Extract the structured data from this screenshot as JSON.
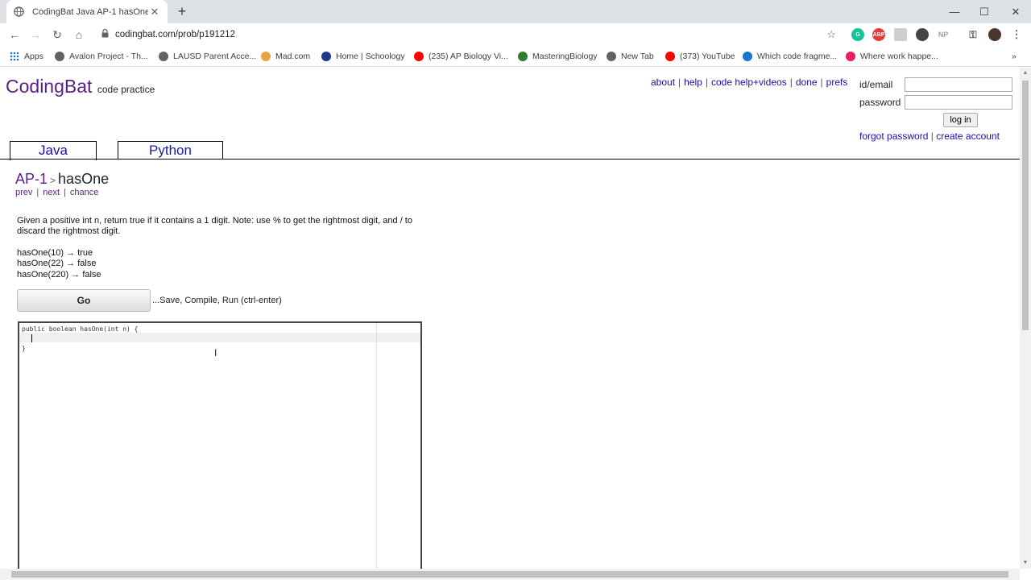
{
  "browser": {
    "tab_title": "CodingBat Java AP-1 hasOne",
    "url": "codingbat.com/prob/p191212",
    "bookmarks": [
      {
        "label": "Apps",
        "color": "#1a73e8"
      },
      {
        "label": "Avalon Project - Th...",
        "color": "#5f6368"
      },
      {
        "label": "LAUSD Parent Acce...",
        "color": "#5f6368"
      },
      {
        "label": "Mad.com",
        "color": "#e8a33d"
      },
      {
        "label": "Home | Schoology",
        "color": "#1e3a8a"
      },
      {
        "label": "(235) AP Biology Vi...",
        "color": "#ff0000"
      },
      {
        "label": "MasteringBiology",
        "color": "#2e7d32"
      },
      {
        "label": "New Tab",
        "color": "#5f6368"
      },
      {
        "label": "(373) YouTube",
        "color": "#ff0000"
      },
      {
        "label": "Which code fragme...",
        "color": "#1976d2"
      },
      {
        "label": "Where work happe...",
        "color": "#e91e63"
      }
    ],
    "extensions": {
      "grammarly": "G",
      "adblock": "ABP",
      "np": "NP"
    }
  },
  "site": {
    "brand": "CodingBat",
    "tagline": "code practice",
    "top_links": [
      "about",
      "help",
      "code help+videos",
      "done",
      "prefs"
    ],
    "login": {
      "id_label": "id/email",
      "password_label": "password",
      "button": "log in",
      "forgot": "forgot password",
      "create": "create account"
    },
    "tabs": [
      "Java",
      "Python"
    ]
  },
  "problem": {
    "category": "AP-1",
    "name": "hasOne",
    "nav": [
      "prev",
      "next",
      "chance"
    ],
    "description": "Given a positive int n, return true if it contains a 1 digit. Note: use % to get the rightmost digit, and / to discard the rightmost digit.",
    "examples": [
      "hasOne(10) → true",
      "hasOne(22) → false",
      "hasOne(220) → false"
    ],
    "go_label": "Go",
    "go_hint": "...Save, Compile, Run (ctrl-enter)",
    "code_lines": [
      "public boolean hasOne(int n) {",
      "  ",
      "}"
    ]
  }
}
